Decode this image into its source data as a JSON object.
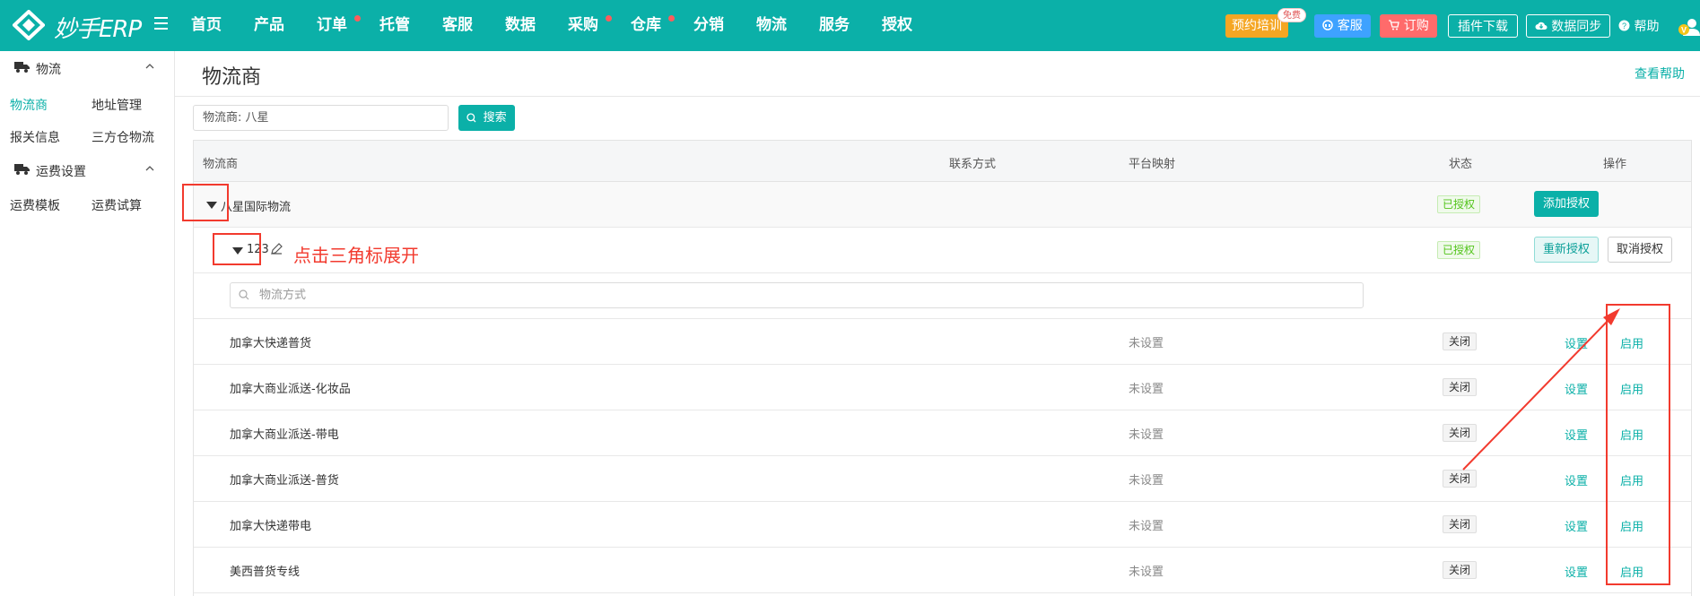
{
  "topbar": {
    "brand": "妙手ERP",
    "nav": [
      {
        "label": "首页",
        "dot": false
      },
      {
        "label": "产品",
        "dot": false
      },
      {
        "label": "订单",
        "dot": true
      },
      {
        "label": "托管",
        "dot": false
      },
      {
        "label": "客服",
        "dot": false
      },
      {
        "label": "数据",
        "dot": false
      },
      {
        "label": "采购",
        "dot": true
      },
      {
        "label": "仓库",
        "dot": true
      },
      {
        "label": "分销",
        "dot": false
      },
      {
        "label": "物流",
        "dot": false
      },
      {
        "label": "服务",
        "dot": false
      },
      {
        "label": "授权",
        "dot": false
      }
    ],
    "training": "预约培训",
    "free_badge": "免费",
    "service": "客服",
    "order": "订购",
    "plugin": "插件下载",
    "sync": "数据同步",
    "help": "帮助"
  },
  "sidebar": {
    "groups": [
      {
        "label": "物流",
        "links": [
          "物流商",
          "地址管理",
          "报关信息",
          "三方仓物流"
        ]
      },
      {
        "label": "运费设置",
        "links": [
          "运费模板",
          "运费试算"
        ]
      }
    ]
  },
  "main": {
    "title": "物流商",
    "help_link": "查看帮助",
    "search": {
      "value": "物流商:  八星",
      "button": "搜索"
    },
    "table": {
      "headers": [
        "物流商",
        "联系方式",
        "平台映射",
        "状态",
        "操作"
      ],
      "provider": {
        "name": "八星国际物流",
        "status": "已授权",
        "action": "添加授权"
      },
      "account": {
        "name": "123",
        "status": "已授权",
        "reauth": "重新授权",
        "cancel": "取消授权"
      },
      "method_placeholder": "物流方式",
      "methods": [
        {
          "name": "加拿大快递普货",
          "mapping": "未设置",
          "status": "关闭",
          "set": "设置",
          "enable": "启用"
        },
        {
          "name": "加拿大商业派送-化妆品",
          "mapping": "未设置",
          "status": "关闭",
          "set": "设置",
          "enable": "启用"
        },
        {
          "name": "加拿大商业派送-带电",
          "mapping": "未设置",
          "status": "关闭",
          "set": "设置",
          "enable": "启用"
        },
        {
          "name": "加拿大商业派送-普货",
          "mapping": "未设置",
          "status": "关闭",
          "set": "设置",
          "enable": "启用"
        },
        {
          "name": "加拿大快递带电",
          "mapping": "未设置",
          "status": "关闭",
          "set": "设置",
          "enable": "启用"
        },
        {
          "name": "美西普货专线",
          "mapping": "未设置",
          "status": "关闭",
          "set": "设置",
          "enable": "启用"
        }
      ]
    }
  },
  "annotation": {
    "text": "点击三角标展开",
    "color": "#f23a2e"
  }
}
